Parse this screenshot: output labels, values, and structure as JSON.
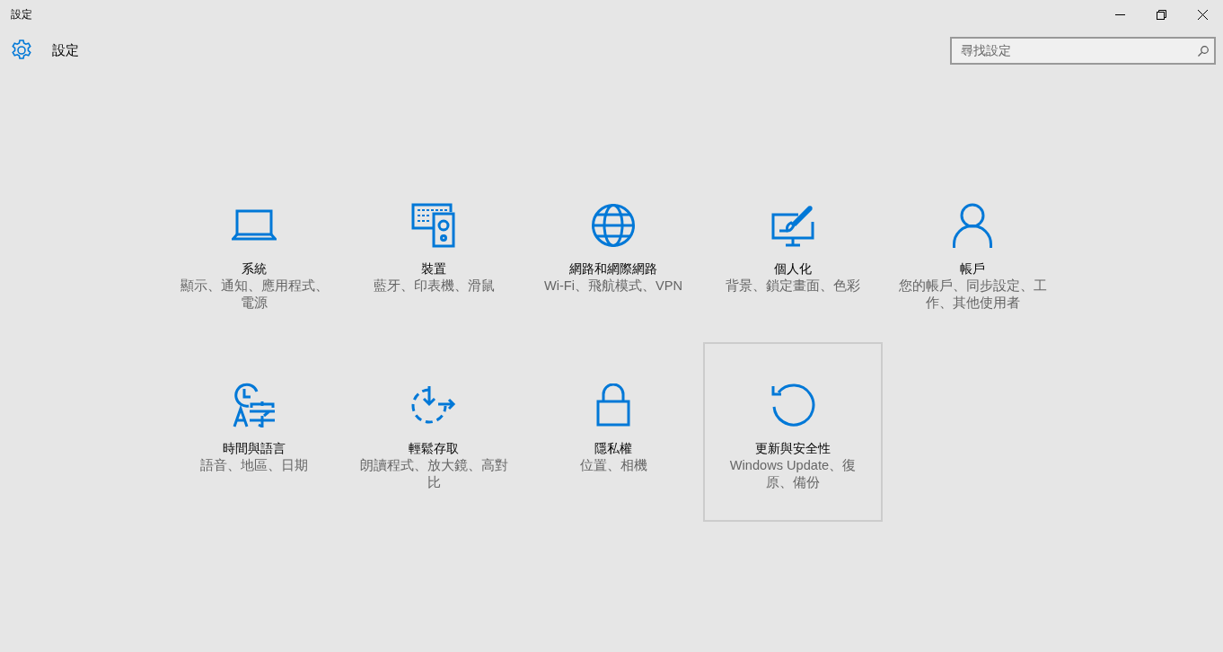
{
  "window": {
    "title": "設定"
  },
  "header": {
    "title": "設定"
  },
  "search": {
    "placeholder": "尋找設定"
  },
  "tiles": [
    {
      "kind": "laptop",
      "title": "系統",
      "description": "顯示、通知、應用程式、電源",
      "selected": false
    },
    {
      "kind": "devices",
      "title": "裝置",
      "description": "藍牙、印表機、滑鼠",
      "selected": false
    },
    {
      "kind": "globe",
      "title": "網路和網際網路",
      "description": "Wi-Fi、飛航模式、VPN",
      "selected": false
    },
    {
      "kind": "paint",
      "title": "個人化",
      "description": "背景、鎖定畫面、色彩",
      "selected": false
    },
    {
      "kind": "person",
      "title": "帳戶",
      "description": "您的帳戶、同步設定、工作、其他使用者",
      "selected": false
    },
    {
      "kind": "language",
      "title": "時間與語言",
      "description": "語音、地區、日期",
      "selected": false
    },
    {
      "kind": "ease",
      "title": "輕鬆存取",
      "description": "朗讀程式、放大鏡、高對比",
      "selected": false
    },
    {
      "kind": "lock",
      "title": "隱私權",
      "description": "位置、相機",
      "selected": false
    },
    {
      "kind": "update",
      "title": "更新與安全性",
      "description": "Windows Update、復原、備份",
      "selected": true
    }
  ]
}
